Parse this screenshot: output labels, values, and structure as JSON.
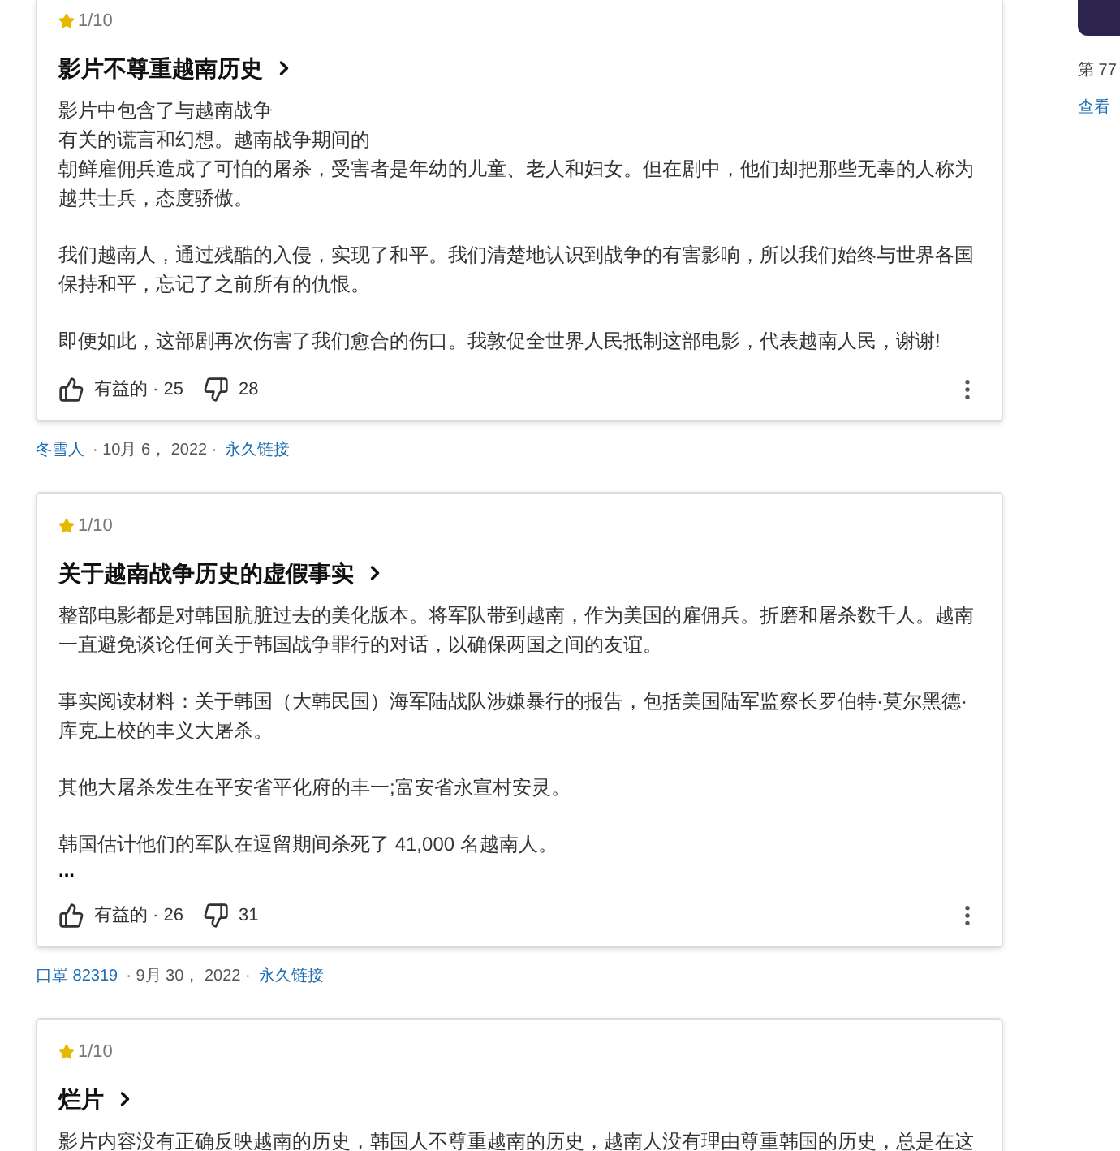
{
  "reviews": [
    {
      "rating": "1/10",
      "title": "影片不尊重越南历史",
      "paragraphs": [
        [
          "影片中包含了与越南战争",
          "有关的谎言和幻想。越南战争期间的",
          "朝鲜雇佣兵造成了可怕的屠杀，受害者是年幼的儿童、老人和妇女。但在剧中，他们却把那些无辜的人称为越共士兵，态度骄傲。"
        ],
        "我们越南人，通过残酷的入侵，实现了和平。我们清楚地认识到战争的有害影响，所以我们始终与世界各国保持和平，忘记了之前所有的仇恨。",
        "即便如此，这部剧再次伤害了我们愈合的伤口。我敦促全世界人民抵制这部电影，代表越南人民，谢谢!"
      ],
      "helpful": "有益的 · 25",
      "unhelpful": "28",
      "author": "冬雪人",
      "date": "· 10月 6， 2022 ·",
      "permalink": "永久链接"
    },
    {
      "rating": "1/10",
      "title": "关于越南战争历史的虚假事实",
      "paragraphs": [
        "整部电影都是对韩国肮脏过去的美化版本。将军队带到越南，作为美国的雇佣兵。折磨和屠杀数千人。越南一直避免谈论任何关于韩国战争罪行的对话，以确保两国之间的友谊。",
        "事实阅读材料：关于韩国（大韩民国）海军陆战队涉嫌暴行的报告，包括美国陆军监察长罗伯特·莫尔黑德·库克上校的丰义大屠杀。",
        "其他大屠杀发生在平安省平化府的丰一;富安省永宣村安灵。",
        "韩国估计他们的军队在逗留期间杀死了 41,000 名越南人。"
      ],
      "more": "...",
      "helpful": "有益的 · 26",
      "unhelpful": "31",
      "author": "口罩 82319",
      "date": "· 9月 30， 2022 ·",
      "permalink": "永久链接"
    },
    {
      "rating": "1/10",
      "title": "烂片",
      "paragraphs": [
        "影片内容没有正确反映越南的历史，韩国人不尊重越南的历史，越南人没有理由尊重韩国的历史，总是在这"
      ]
    }
  ],
  "side": {
    "caption": "第 77",
    "link": "查看"
  }
}
